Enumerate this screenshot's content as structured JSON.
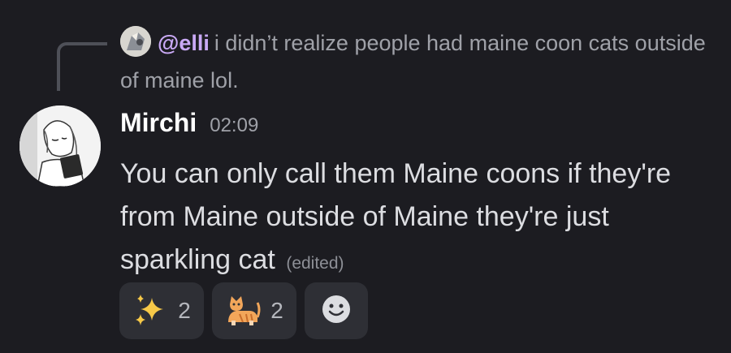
{
  "reply": {
    "mention": "@elli",
    "text": "i didn’t realize people had maine coon cats outside of maine lol."
  },
  "message": {
    "author": "Mirchi",
    "timestamp": "02:09",
    "text": "You can only call them Maine coons if they're from Maine outside of Maine they're just sparkling cat",
    "edited_label": "(edited)"
  },
  "reactions": [
    {
      "emoji": "sparkles-icon",
      "count": "2"
    },
    {
      "emoji": "cat-icon",
      "count": "2"
    }
  ],
  "add_reaction": {
    "icon": "smiley-icon"
  },
  "colors": {
    "background": "#1c1c21",
    "mention": "#c9a9f5",
    "reaction_bg": "#2e2f35"
  }
}
